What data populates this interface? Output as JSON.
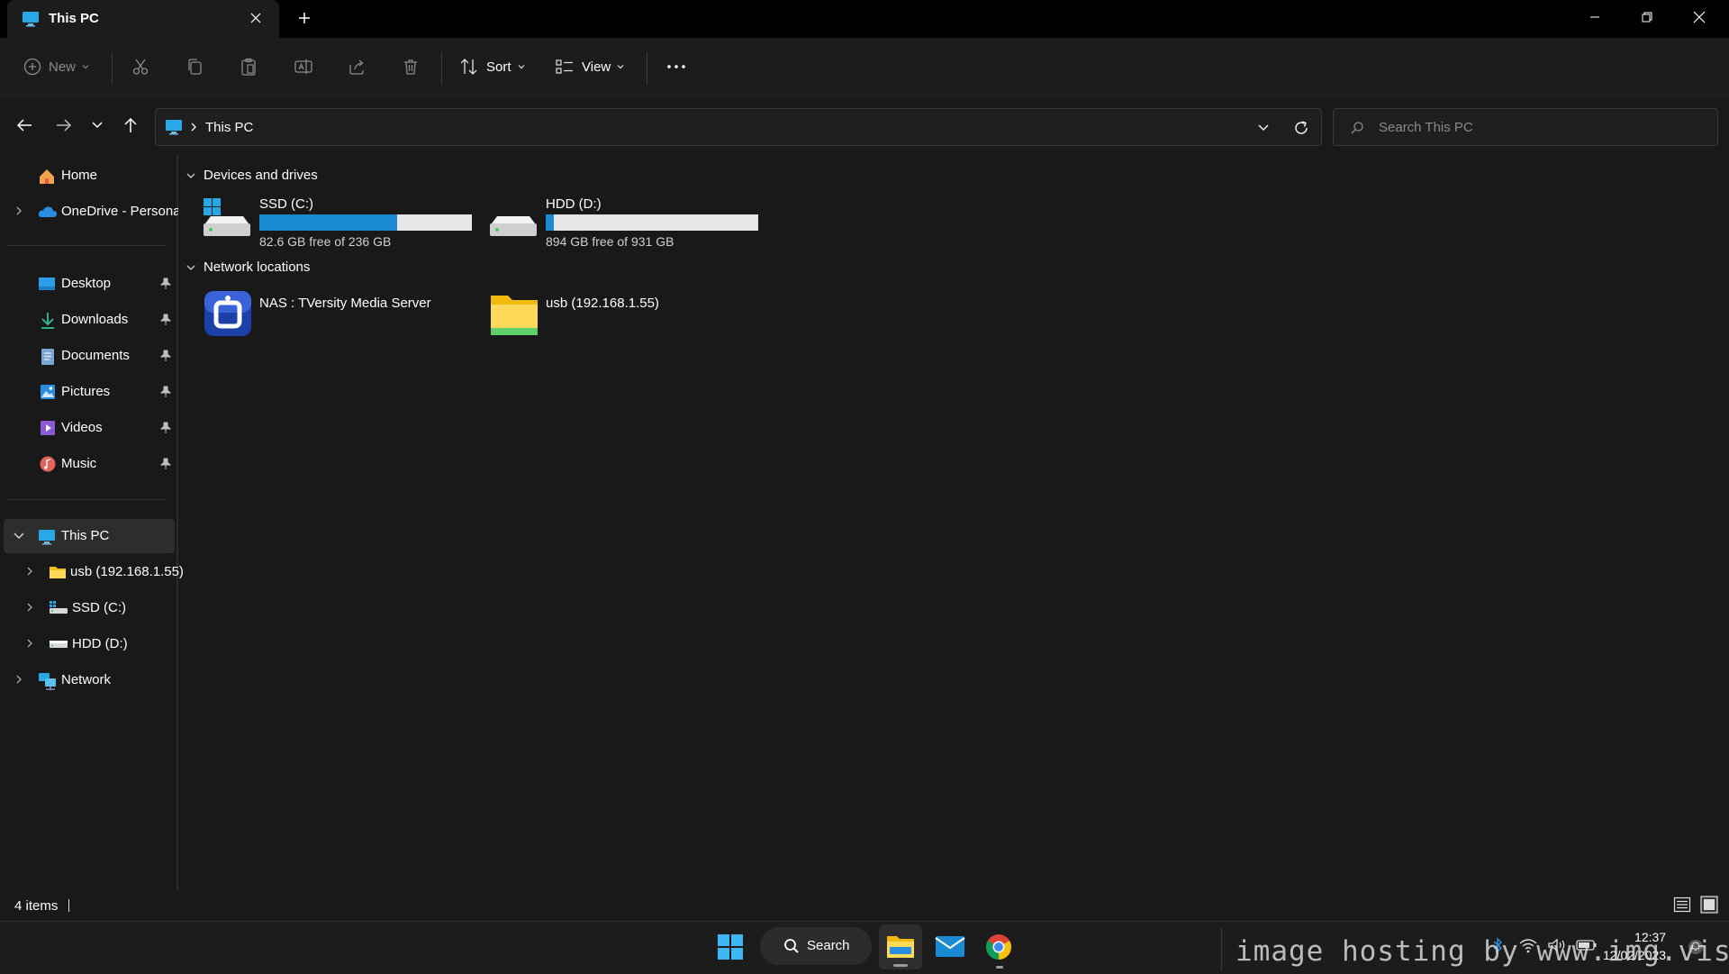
{
  "window": {
    "tab_title": "This PC",
    "tab_icon": "monitor-icon",
    "new_tab_icon": "plus-icon",
    "controls": [
      "minimize-icon",
      "restore-icon",
      "close-icon"
    ]
  },
  "toolbar": {
    "new_label": "New",
    "sort_label": "Sort",
    "view_label": "View",
    "icons": [
      "cut-icon",
      "copy-icon",
      "paste-icon",
      "rename-icon",
      "share-icon",
      "delete-icon",
      "more-icon"
    ]
  },
  "address": {
    "path": "This PC",
    "search_placeholder": "Search This PC"
  },
  "sidebar": {
    "home": "Home",
    "onedrive": "OneDrive - Persona",
    "quick": [
      {
        "label": "Desktop",
        "icon": "desktop-icon"
      },
      {
        "label": "Downloads",
        "icon": "download-icon"
      },
      {
        "label": "Documents",
        "icon": "document-icon"
      },
      {
        "label": "Pictures",
        "icon": "picture-icon"
      },
      {
        "label": "Videos",
        "icon": "video-icon"
      },
      {
        "label": "Music",
        "icon": "music-icon"
      }
    ],
    "this_pc": "This PC",
    "children": [
      "usb (192.168.1.55)",
      "SSD (C:)",
      "HDD (D:)"
    ],
    "network": "Network"
  },
  "content": {
    "devices_header": "Devices and drives",
    "network_header": "Network locations",
    "drives": [
      {
        "name": "SSD (C:)",
        "free": "82.6 GB free of 236 GB",
        "used_fraction": 0.65
      },
      {
        "name": "HDD (D:)",
        "free": "894 GB free of 931 GB",
        "used_fraction": 0.04
      }
    ],
    "locations": [
      {
        "name": "NAS : TVersity Media Server",
        "icon": "media-server-icon"
      },
      {
        "name": "usb (192.168.1.55)",
        "icon": "folder-icon"
      }
    ]
  },
  "status": {
    "items_count": "4 items"
  },
  "taskbar": {
    "search_label": "Search",
    "apps": [
      "windows-start-icon",
      "file-explorer-icon",
      "mail-icon",
      "chrome-icon"
    ],
    "time": "12:37",
    "date": "12/02/2023",
    "watermark": "image hosting by www.img.vision"
  },
  "colors": {
    "accent": "#1a8ad4",
    "background": "#191919"
  }
}
